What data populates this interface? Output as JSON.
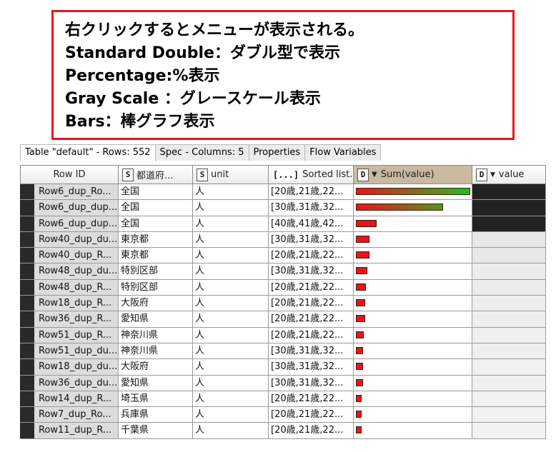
{
  "callout": {
    "lines": [
      "右クリックするとメニューが表示される。",
      "Standard Double：ダブル型で表示",
      "Percentage:%表示",
      "Gray Scale ：グレースケール表示",
      "Bars：棒グラフ表示"
    ],
    "border_color": "#e8141c"
  },
  "tabs": [
    {
      "label": "Table \"default\" - Rows: 552",
      "active": true
    },
    {
      "label": "Spec - Columns: 5",
      "active": false
    },
    {
      "label": "Properties",
      "active": false
    },
    {
      "label": "Flow Variables",
      "active": false
    }
  ],
  "columns": [
    {
      "label": "Row ID",
      "type": ""
    },
    {
      "label": "都道府...",
      "type": "S"
    },
    {
      "label": "unit",
      "type": "S"
    },
    {
      "label": "Sorted list...",
      "type": "[...]"
    },
    {
      "label": "Sum(value)",
      "type": "D",
      "sorted_desc": true,
      "selected": true
    },
    {
      "label": "value",
      "type": "D",
      "has_dropdown": true
    }
  ],
  "rows": [
    {
      "id": "Row6_dup_Ro...",
      "pref": "全国",
      "unit": "人",
      "list": "[20歳,21歳,22...",
      "sum_fraction": 1.0,
      "value_shade": "#222222"
    },
    {
      "id": "Row6_dup_dup...",
      "pref": "全国",
      "unit": "人",
      "list": "[30歳,31歳,32...",
      "sum_fraction": 0.76,
      "value_shade": "#222222"
    },
    {
      "id": "Row6_dup_dup...",
      "pref": "全国",
      "unit": "人",
      "list": "[40歳,41歳,42...",
      "sum_fraction": 0.18,
      "value_shade": "#222222"
    },
    {
      "id": "Row40_dup_du...",
      "pref": "東京都",
      "unit": "人",
      "list": "[30歳,31歳,32...",
      "sum_fraction": 0.12,
      "value_shade": "#e8e8e8"
    },
    {
      "id": "Row40_dup_R...",
      "pref": "東京都",
      "unit": "人",
      "list": "[20歳,21歳,22...",
      "sum_fraction": 0.12,
      "value_shade": "#e8e8e8"
    },
    {
      "id": "Row48_dup_du...",
      "pref": "特別区部",
      "unit": "人",
      "list": "[30歳,31歳,32...",
      "sum_fraction": 0.1,
      "value_shade": "#ececec"
    },
    {
      "id": "Row48_dup_R...",
      "pref": "特別区部",
      "unit": "人",
      "list": "[20歳,21歳,22...",
      "sum_fraction": 0.09,
      "value_shade": "#ececec"
    },
    {
      "id": "Row18_dup_R...",
      "pref": "大阪府",
      "unit": "人",
      "list": "[20歳,21歳,22...",
      "sum_fraction": 0.08,
      "value_shade": "#eeeeee"
    },
    {
      "id": "Row36_dup_R...",
      "pref": "愛知県",
      "unit": "人",
      "list": "[20歳,21歳,22...",
      "sum_fraction": 0.08,
      "value_shade": "#eeeeee"
    },
    {
      "id": "Row51_dup_R...",
      "pref": "神奈川県",
      "unit": "人",
      "list": "[20歳,21歳,22...",
      "sum_fraction": 0.07,
      "value_shade": "#efefef"
    },
    {
      "id": "Row51_dup_du...",
      "pref": "神奈川県",
      "unit": "人",
      "list": "[30歳,31歳,32...",
      "sum_fraction": 0.06,
      "value_shade": "#efefef"
    },
    {
      "id": "Row18_dup_du...",
      "pref": "大阪府",
      "unit": "人",
      "list": "[30歳,31歳,32...",
      "sum_fraction": 0.06,
      "value_shade": "#f0f0f0"
    },
    {
      "id": "Row36_dup_du...",
      "pref": "愛知県",
      "unit": "人",
      "list": "[30歳,31歳,32...",
      "sum_fraction": 0.06,
      "value_shade": "#f0f0f0"
    },
    {
      "id": "Row14_dup_R...",
      "pref": "埼玉県",
      "unit": "人",
      "list": "[20歳,21歳,22...",
      "sum_fraction": 0.05,
      "value_shade": "#f1f1f1"
    },
    {
      "id": "Row7_dup_Ro...",
      "pref": "兵庫県",
      "unit": "人",
      "list": "[20歳,21歳,22...",
      "sum_fraction": 0.05,
      "value_shade": "#f1f1f1"
    },
    {
      "id": "Row11_dup_R...",
      "pref": "千葉県",
      "unit": "人",
      "list": "[20歳,21歳,22...",
      "sum_fraction": 0.05,
      "value_shade": "#f2f2f2"
    }
  ],
  "colors": {
    "bar_low": "#e8141c",
    "bar_high": "#22c01e",
    "header_selected": "#c8b99f"
  }
}
